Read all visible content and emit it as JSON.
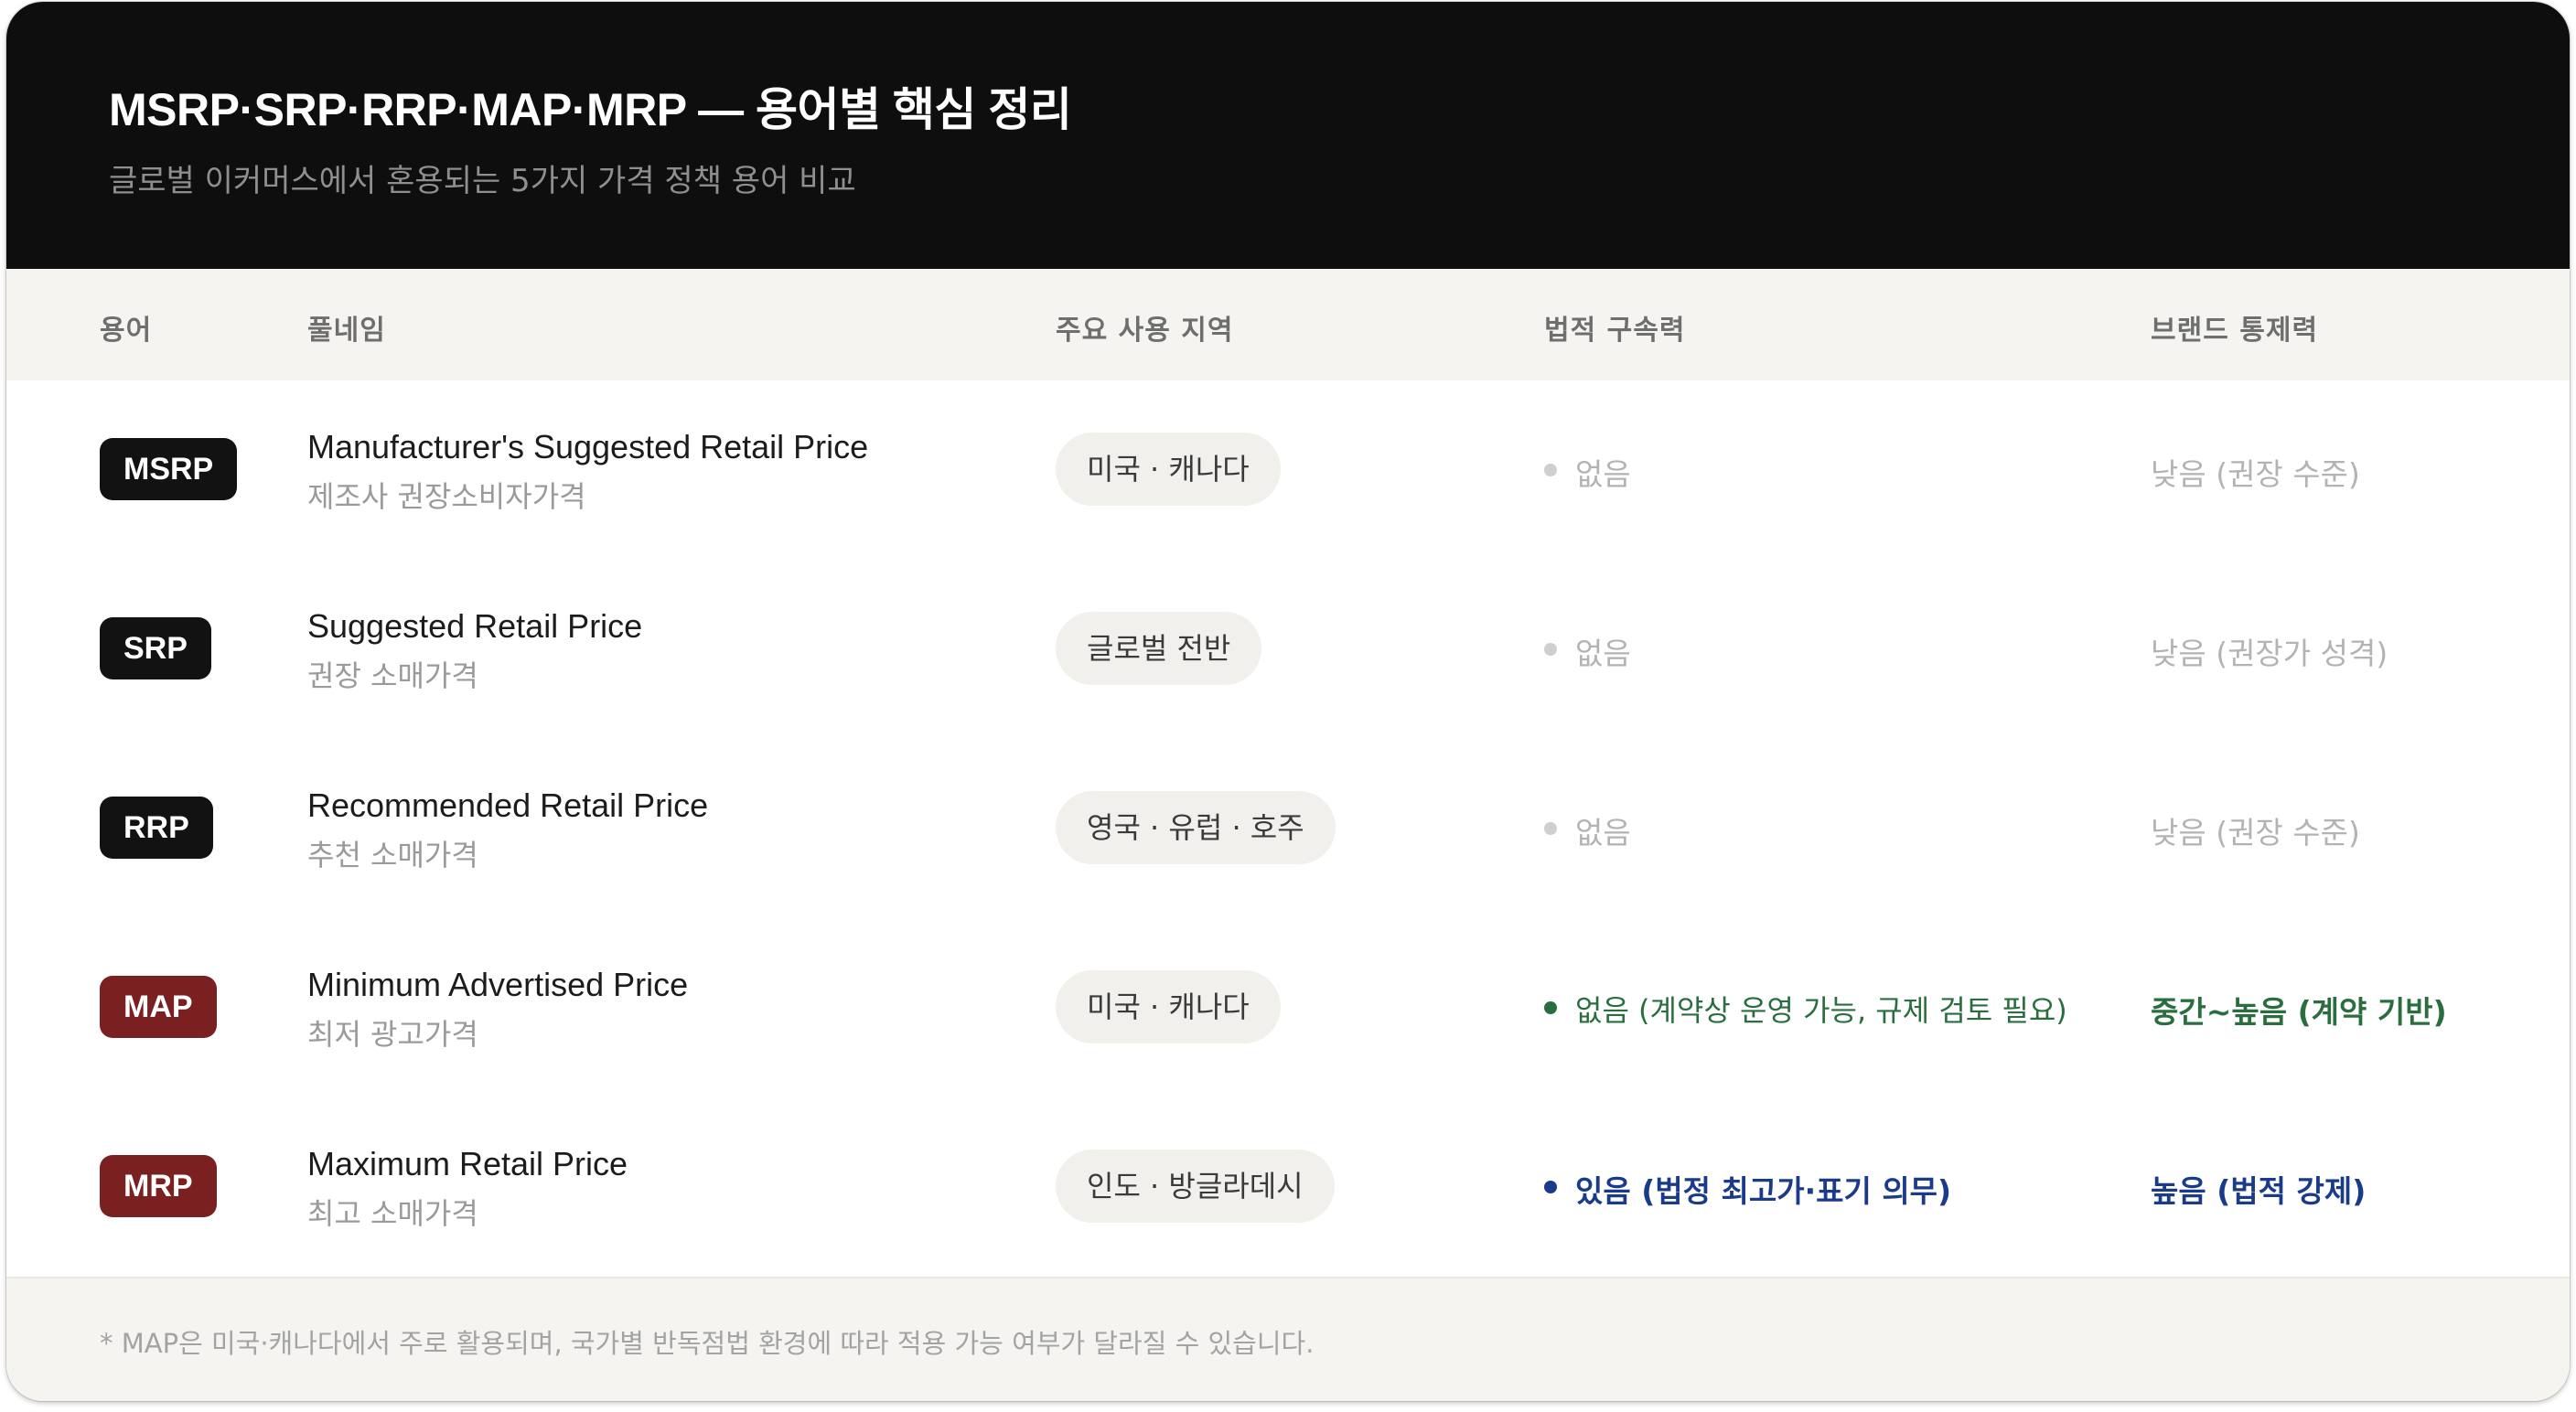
{
  "header": {
    "title": "MSRP·SRP·RRP·MAP·MRP — 용어별 핵심 정리",
    "subtitle": "글로벌 이커머스에서 혼용되는 5가지 가격 정책 용어 비교"
  },
  "columns": [
    "용어",
    "풀네임",
    "주요 사용 지역",
    "법적 구속력",
    "브랜드 통제력"
  ],
  "rows": [
    {
      "term": "MSRP",
      "full_name": "Manufacturer's Suggested Retail Price",
      "korean_name": "제조사 권장소비자가격",
      "region": "미국 · 캐나다",
      "legal": "없음",
      "control": "낮음 (권장 수준)"
    },
    {
      "term": "SRP",
      "full_name": "Suggested Retail Price",
      "korean_name": "권장 소매가격",
      "region": "글로벌 전반",
      "legal": "없음",
      "control": "낮음 (권장가 성격)"
    },
    {
      "term": "RRP",
      "full_name": "Recommended Retail Price",
      "korean_name": "추천 소매가격",
      "region": "영국 · 유럽 · 호주",
      "legal": "없음",
      "control": "낮음 (권장 수준)"
    },
    {
      "term": "MAP",
      "full_name": "Minimum Advertised Price",
      "korean_name": "최저 광고가격",
      "region": "미국 · 캐나다",
      "legal": "없음 (계약상 운영 가능, 규제 검토 필요)",
      "control": "중간~높음 (계약 기반)"
    },
    {
      "term": "MRP",
      "full_name": "Maximum Retail Price",
      "korean_name": "최고 소매가격",
      "region": "인도 · 방글라데시",
      "legal": "있음 (법정 최고가·표기 의무)",
      "control": "높음 (법적 강제)"
    }
  ],
  "colors": {
    "header_bg": "#0e0e0e",
    "badge_dark": "#121212",
    "badge_red": "#7b2021",
    "status_muted": "#b3b3b3",
    "status_green": "#2a6e3f",
    "status_navy": "#1a3a8a"
  },
  "footer": {
    "note": "* MAP은 미국·캐나다에서 주로 활용되며, 국가별 반독점법 환경에 따라 적용 가능 여부가 달라질 수 있습니다."
  }
}
